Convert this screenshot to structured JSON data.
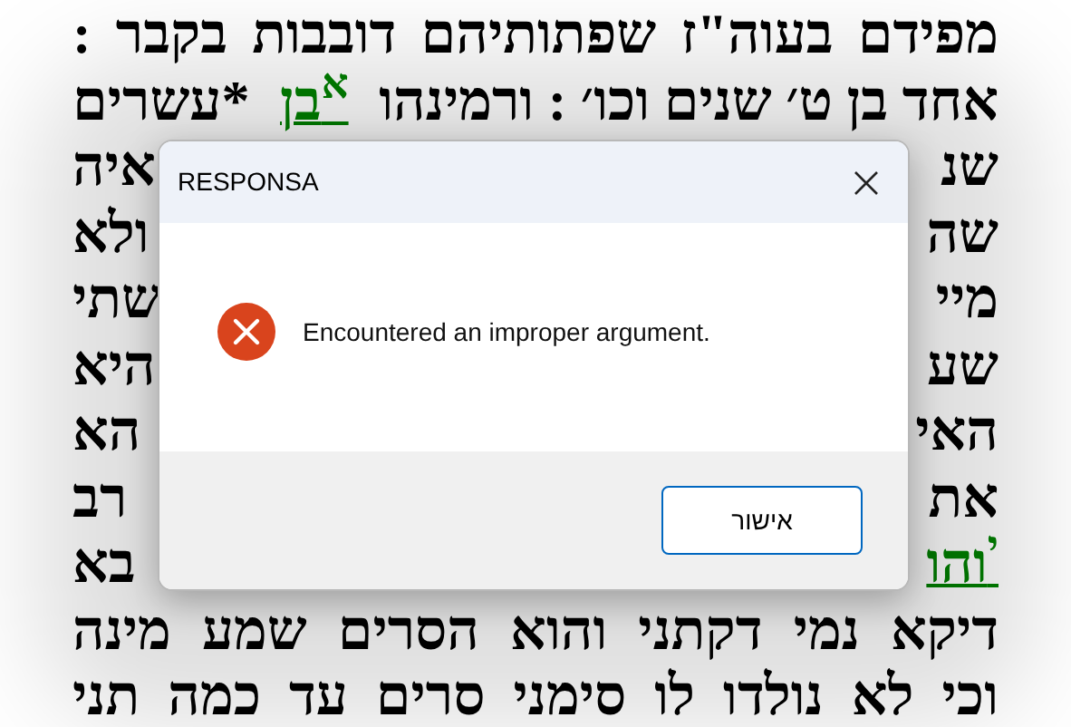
{
  "text_lines": [
    {
      "kind": "full",
      "segments": [
        {
          "text": "מפידם  בעוה\"ז שפתותיהם דובבות בקבר :",
          "kind": "plain"
        }
      ]
    },
    {
      "kind": "full",
      "segments": [
        {
          "text": "אחד בן ט׳ שנים וכו׳ : ורמינהו ",
          "kind": "plain"
        },
        {
          "text": "$^{א}$בן",
          "kind": "link"
        },
        {
          "text": " *עשרים",
          "kind": "plain"
        }
      ]
    },
    {
      "kind": "split",
      "start": {
        "text": "שנ",
        "kind": "plain"
      },
      "end": {
        "text": "איה",
        "kind": "plain"
      }
    },
    {
      "kind": "split",
      "start": {
        "text": "שה",
        "kind": "plain"
      },
      "end": {
        "text": "ולא",
        "kind": "plain"
      }
    },
    {
      "kind": "split",
      "start": {
        "text": "מיי",
        "kind": "plain"
      },
      "end": {
        "text": "שתי",
        "kind": "plain"
      }
    },
    {
      "kind": "split",
      "start": {
        "text": "שע",
        "kind": "plain"
      },
      "end": {
        "text": "היא",
        "kind": "plain"
      }
    },
    {
      "kind": "split",
      "start": {
        "text": "האי",
        "kind": "plain"
      },
      "end": {
        "text": "הא",
        "kind": "plain"
      }
    },
    {
      "kind": "split",
      "start": {
        "text": "את",
        "kind": "plain"
      },
      "end": {
        "text": "רב",
        "kind": "plain"
      }
    },
    {
      "kind": "split",
      "start": {
        "text": "$^{י}$והו",
        "kind": "link"
      },
      "end": {
        "text": "בא",
        "kind": "plain"
      }
    },
    {
      "kind": "full",
      "segments": [
        {
          "text": "דיקא נמי דקתני והוא הסרים שמע מינה",
          "kind": "plain"
        }
      ]
    },
    {
      "kind": "full",
      "segments": [
        {
          "text": "וכי לא נולדו לו סימני סרים עד כמה תני",
          "kind": "plain"
        }
      ]
    }
  ],
  "dialog": {
    "title": "RESPONSA",
    "kind": "error",
    "message": "Encountered an improper argument.",
    "buttons": [
      "אישור"
    ]
  }
}
